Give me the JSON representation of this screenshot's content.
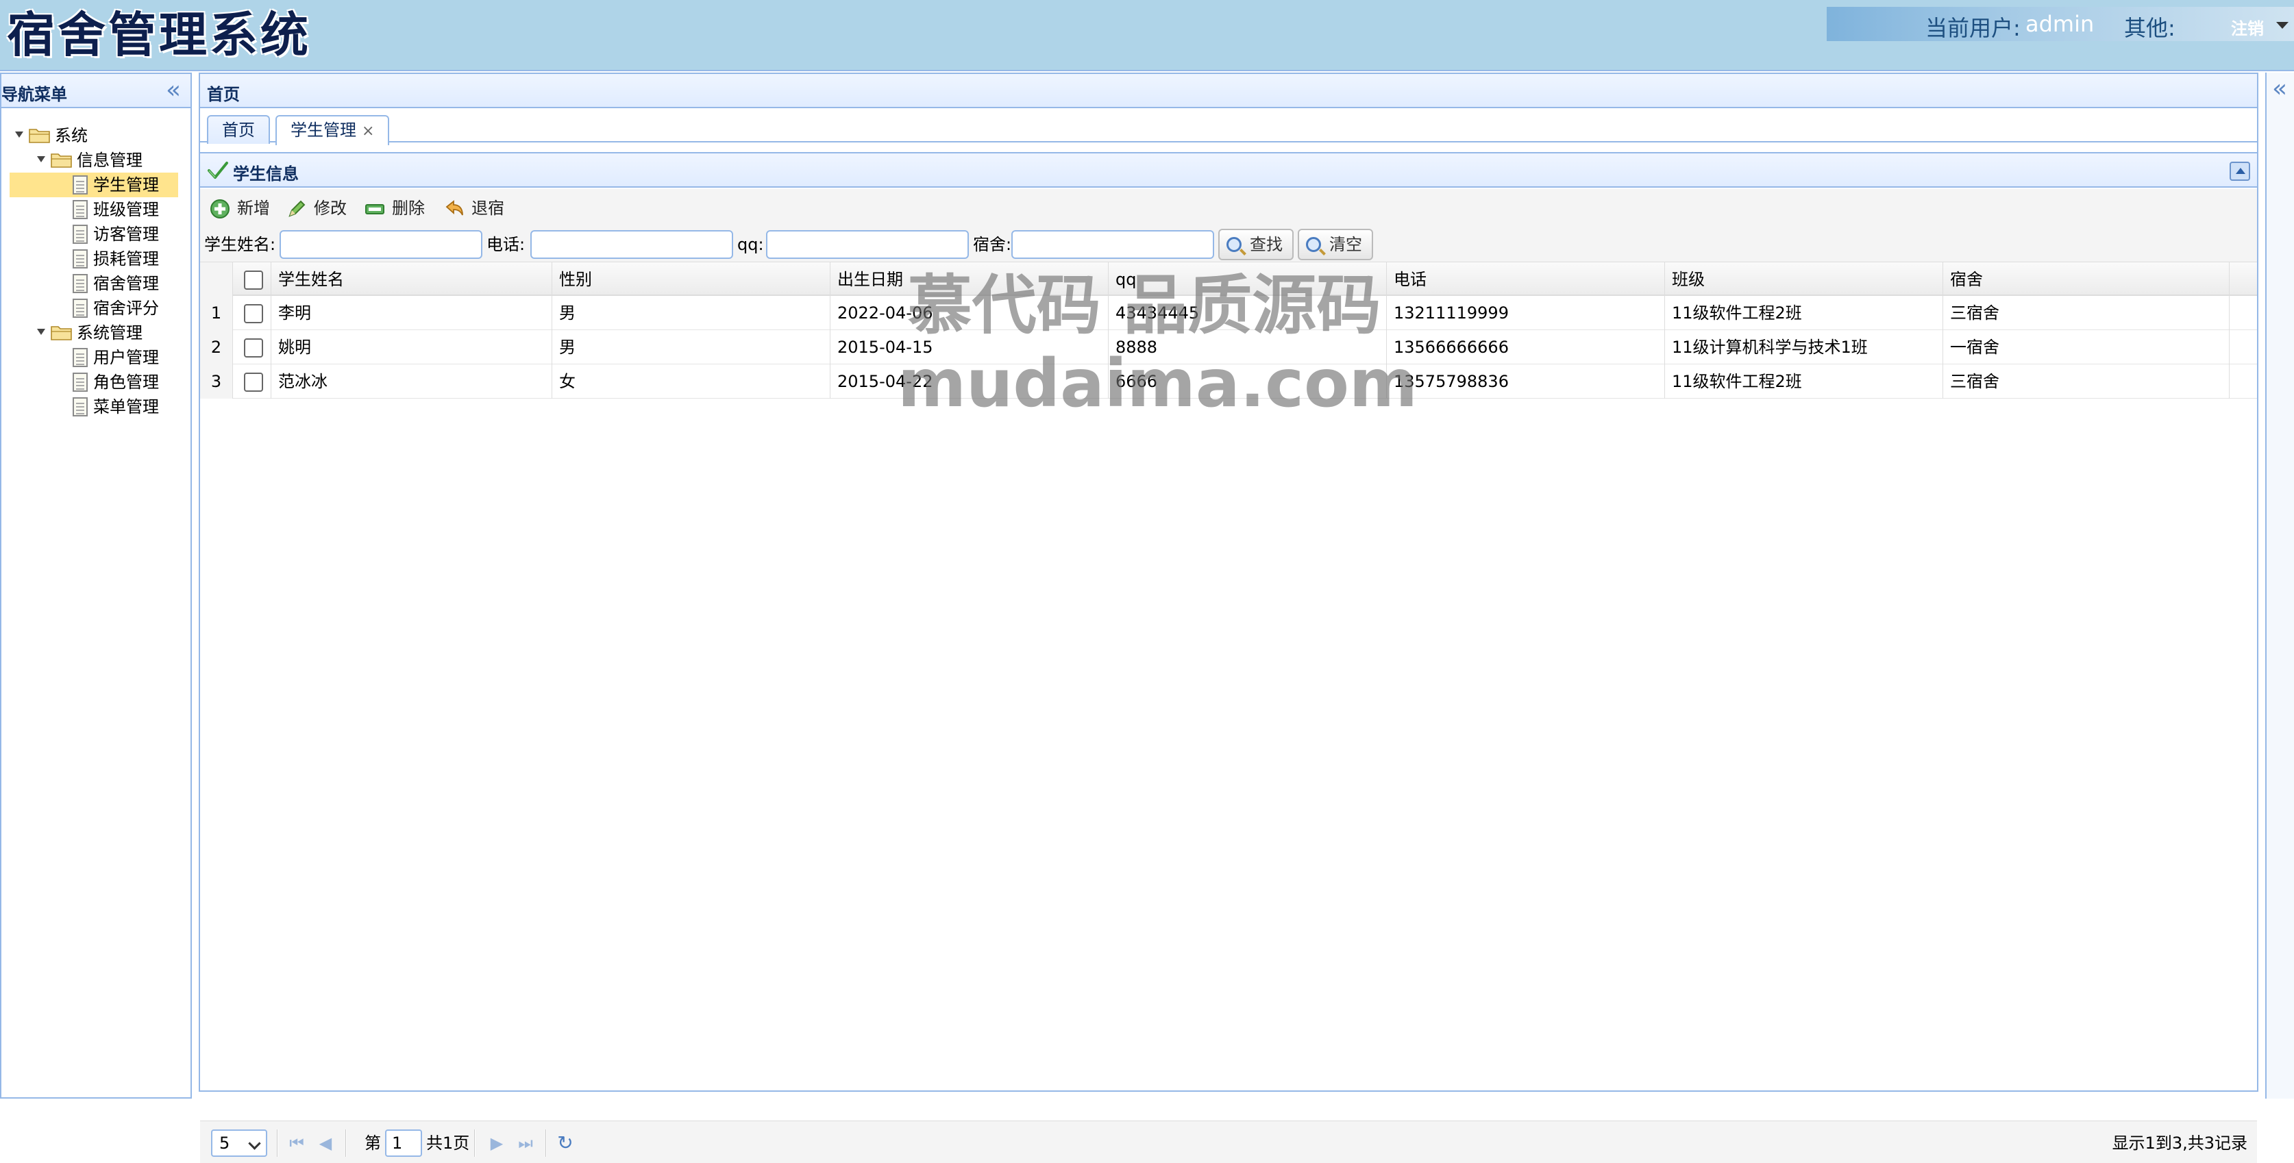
{
  "header": {
    "app_title": "宿舍管理系统",
    "user_label": "当前用户:",
    "user_name": "admin",
    "other_label": "其他:",
    "logout_label": "注销"
  },
  "nav": {
    "title": "导航菜单",
    "tree": [
      {
        "label": "系统",
        "level": 0,
        "type": "folder"
      },
      {
        "label": "信息管理",
        "level": 1,
        "type": "folder"
      },
      {
        "label": "学生管理",
        "level": 2,
        "type": "file",
        "selected": true
      },
      {
        "label": "班级管理",
        "level": 2,
        "type": "file"
      },
      {
        "label": "访客管理",
        "level": 2,
        "type": "file"
      },
      {
        "label": "损耗管理",
        "level": 2,
        "type": "file"
      },
      {
        "label": "宿舍管理",
        "level": 2,
        "type": "file"
      },
      {
        "label": "宿舍评分",
        "level": 2,
        "type": "file"
      },
      {
        "label": "系统管理",
        "level": 1,
        "type": "folder"
      },
      {
        "label": "用户管理",
        "level": 2,
        "type": "file"
      },
      {
        "label": "角色管理",
        "level": 2,
        "type": "file"
      },
      {
        "label": "菜单管理",
        "level": 2,
        "type": "file"
      }
    ]
  },
  "main": {
    "title": "首页",
    "tabs": [
      {
        "label": "首页",
        "active": false,
        "closable": false
      },
      {
        "label": "学生管理",
        "active": true,
        "closable": true
      }
    ],
    "tab_close_glyph": "×"
  },
  "grid": {
    "title": "学生信息",
    "toolbar": {
      "add": "新增",
      "edit": "修改",
      "delete": "删除",
      "checkout": "退宿"
    },
    "search": {
      "name_label": "学生姓名:",
      "phone_label": "电话:",
      "qq_label": "qq:",
      "dorm_label": "宿舍:",
      "find_button": "查找",
      "clear_button": "清空"
    },
    "columns": [
      "学生姓名",
      "性别",
      "出生日期",
      "qq",
      "电话",
      "班级",
      "宿舍"
    ],
    "rows": [
      {
        "num": "1",
        "cells": [
          "李明",
          "男",
          "2022-04-06",
          "43434445",
          "13211119999",
          "11级软件工程2班",
          "三宿舍"
        ]
      },
      {
        "num": "2",
        "cells": [
          "姚明",
          "男",
          "2015-04-15",
          "8888",
          "13566666666",
          "11级计算机科学与技术1班",
          "一宿舍"
        ]
      },
      {
        "num": "3",
        "cells": [
          "范冰冰",
          "女",
          "2015-04-22",
          "6666",
          "13575798836",
          "11级软件工程2班",
          "三宿舍"
        ]
      }
    ],
    "pager": {
      "page_size": "5",
      "page_prefix": "第",
      "page_value": "1",
      "page_suffix": "共1页",
      "info": "显示1到3,共3记录"
    }
  },
  "watermark": {
    "line1": "慕代码 品质源码",
    "line2": "mudaima.com"
  },
  "colors": {
    "header_bg": "#afd4e8",
    "panel_border": "#95b8e7",
    "selected_row": "#ffe48d",
    "title_text": "#0e2d5f"
  }
}
